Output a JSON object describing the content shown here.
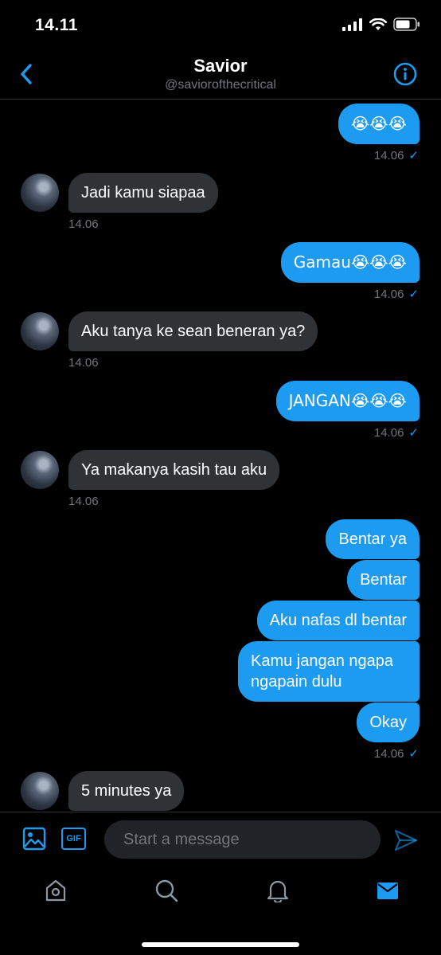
{
  "status": {
    "time": "14.11"
  },
  "header": {
    "name": "Savior",
    "handle": "@saviorofthecritical"
  },
  "messages": [
    {
      "dir": "out",
      "text": "😭😭😭",
      "time": "14.06"
    },
    {
      "dir": "in",
      "text": "Jadi kamu siapaa",
      "time": "14.06"
    },
    {
      "dir": "out",
      "text": "Gamau😭😭😭",
      "time": "14.06"
    },
    {
      "dir": "in",
      "text": "Aku tanya ke sean beneran ya?",
      "time": "14.06"
    },
    {
      "dir": "out",
      "text": "JANGAN😭😭😭",
      "time": "14.06"
    },
    {
      "dir": "in",
      "text": "Ya makanya kasih tau aku",
      "time": "14.06"
    },
    {
      "dir": "out",
      "text": "Bentar ya"
    },
    {
      "dir": "out",
      "text": "Bentar"
    },
    {
      "dir": "out",
      "text": "Aku nafas dl bentar"
    },
    {
      "dir": "out",
      "text": "Kamu jangan ngapa ngapain dulu"
    },
    {
      "dir": "out",
      "text": "Okay",
      "time": "14.06"
    },
    {
      "dir": "in",
      "text": "5 minutes ya"
    }
  ],
  "composer": {
    "placeholder": "Start a message",
    "gif_label": "GIF"
  },
  "colors": {
    "accent": "#1d9bf0",
    "incoming": "#2f3336",
    "background": "#000000"
  }
}
